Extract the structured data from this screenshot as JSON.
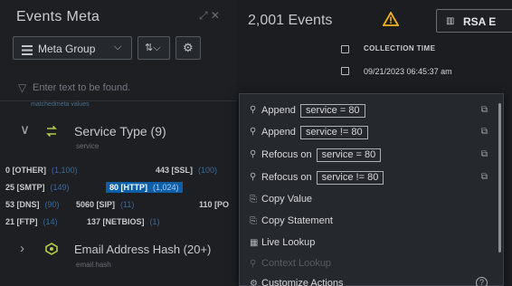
{
  "left_panel": {
    "title": "Events Meta",
    "tools_glyph": "⤢ ✕",
    "meta_group_label": "Meta Group",
    "filter_placeholder": "Enter text to be found.",
    "cut_off_label": "matchedmeta values",
    "service_type": {
      "title": "Service Type (9)",
      "key": "service",
      "values": [
        {
          "label": "0 [OTHER]",
          "count": "(1,100)"
        },
        {
          "label": "443 [SSL]",
          "count": "(100)"
        },
        {
          "label": "25 [SMTP]",
          "count": "(149)"
        },
        {
          "label": "80 [HTTP]",
          "count": "(1,024)",
          "highlighted": true
        },
        {
          "label": "53 [DNS]",
          "count": "(90)"
        },
        {
          "label": "5060 [SIP]",
          "count": "(11)"
        },
        {
          "label": "110 [PO",
          "count": ""
        },
        {
          "label": "21 [FTP]",
          "count": "(14)"
        },
        {
          "label": "137 [NETBIOS]",
          "count": "(1)"
        }
      ]
    },
    "email_hash": {
      "title": "Email Address Hash (20+)",
      "key": "email.hash"
    }
  },
  "events_panel": {
    "count_label": "2,001 Events",
    "rsa_button_label": "RSA E",
    "column_header": "COLLECTION TIME",
    "rows": [
      {
        "time": "09/21/2023 06:45:37 am"
      }
    ]
  },
  "context_menu": {
    "items": [
      {
        "label": "Append",
        "query": "service = 80",
        "icon": "search-icon",
        "external": true
      },
      {
        "label": "Append",
        "query": "service != 80",
        "icon": "search-icon",
        "external": true
      },
      {
        "label": "Refocus on",
        "query": "service = 80",
        "icon": "search-icon",
        "external": true
      },
      {
        "label": "Refocus on",
        "query": "service != 80",
        "icon": "search-icon",
        "external": true
      },
      {
        "label": "Copy Value",
        "icon": "copy-icon"
      },
      {
        "label": "Copy Statement",
        "icon": "copy-icon"
      },
      {
        "label": "Live Lookup",
        "icon": "live-lookup-icon"
      },
      {
        "label": "Context Lookup",
        "icon": "context-lookup-icon",
        "disabled": true
      },
      {
        "label": "Customize Actions",
        "icon": "gear-icon",
        "help": "?"
      }
    ]
  },
  "colors": {
    "highlight_bg": "#0e5fa8",
    "count_blue": "#3b6a9c",
    "warning": "#f2b21b",
    "service_icon": "#b4c94a"
  }
}
